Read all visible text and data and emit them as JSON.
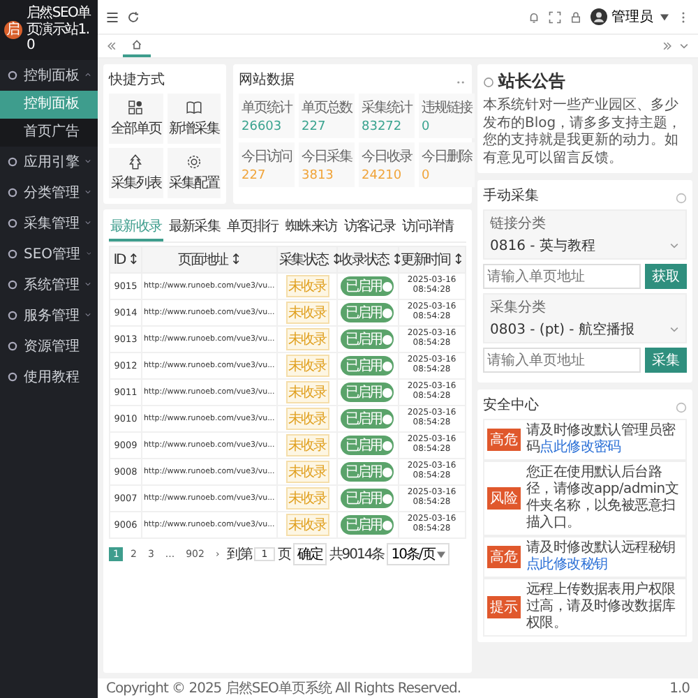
{
  "sidebar": {
    "logo_mark": "启",
    "title": "启然SEO单页演示站1.0",
    "items": [
      {
        "label": "控制面板",
        "kind": "group",
        "expanded": true,
        "children": [
          {
            "label": "控制面板",
            "selected": true
          },
          {
            "label": "首页广告",
            "selected": false
          }
        ]
      },
      {
        "label": "应用引擎",
        "kind": "group",
        "expanded": false
      },
      {
        "label": "分类管理",
        "kind": "group",
        "expanded": false
      },
      {
        "label": "采集管理",
        "kind": "group",
        "expanded": false
      },
      {
        "label": "SEO管理",
        "kind": "group",
        "expanded": false
      },
      {
        "label": "系统管理",
        "kind": "group",
        "expanded": false
      },
      {
        "label": "服务管理",
        "kind": "group",
        "expanded": false
      },
      {
        "label": "资源管理",
        "kind": "link"
      },
      {
        "label": "使用教程",
        "kind": "link"
      }
    ]
  },
  "topbar": {
    "user": "管理员"
  },
  "quick": {
    "title": "快捷方式",
    "items": [
      {
        "label": "全部单页"
      },
      {
        "label": "新增采集"
      },
      {
        "label": "采集列表"
      },
      {
        "label": "采集配置"
      }
    ]
  },
  "stats": {
    "title": "网站数据",
    "items": [
      {
        "label": "单页统计",
        "value": "26603",
        "color": "#3aa38f"
      },
      {
        "label": "单页总数",
        "value": "227",
        "color": "#3aa38f"
      },
      {
        "label": "采集统计",
        "value": "83272",
        "color": "#3aa38f"
      },
      {
        "label": "违规链接",
        "value": "0",
        "color": "#3aa38f"
      },
      {
        "label": "今日访问",
        "value": "227",
        "color": "#f0a43a"
      },
      {
        "label": "今日采集",
        "value": "3813",
        "color": "#f0a43a"
      },
      {
        "label": "今日收录",
        "value": "24210",
        "color": "#f0a43a"
      },
      {
        "label": "今日删除",
        "value": "0",
        "color": "#f0a43a"
      }
    ]
  },
  "table_tabs": [
    {
      "label": "最新收录",
      "selected": true
    },
    {
      "label": "最新采集",
      "selected": false
    },
    {
      "label": "单页排行",
      "selected": false
    },
    {
      "label": "蜘蛛来访",
      "selected": false
    },
    {
      "label": "访客记录",
      "selected": false
    },
    {
      "label": "访问详情",
      "selected": false
    }
  ],
  "table": {
    "columns": [
      "ID ↕",
      "页面地址 ↕",
      "采集状态 ↕",
      "收录状态 ↕",
      "更新时间 ↕"
    ],
    "rows": [
      {
        "id": "9015",
        "url": "http://www.runoeb.com/vue3/vu...",
        "status": "未收录",
        "toggle": "已启用",
        "on": true,
        "time": "2025-03-16 08:54:28"
      },
      {
        "id": "9014",
        "url": "http://www.runoeb.com/vue3/vu...",
        "status": "未收录",
        "toggle": "已启用",
        "on": true,
        "time": "2025-03-16 08:54:28"
      },
      {
        "id": "9013",
        "url": "http://www.runoeb.com/vue3/vu...",
        "status": "未收录",
        "toggle": "已启用",
        "on": true,
        "time": "2025-03-16 08:54:28"
      },
      {
        "id": "9012",
        "url": "http://www.runoeb.com/vue3/vu...",
        "status": "未收录",
        "toggle": "已启用",
        "on": true,
        "time": "2025-03-16 08:54:28"
      },
      {
        "id": "9011",
        "url": "http://www.runoeb.com/vue3/vu...",
        "status": "未收录",
        "toggle": "已启用",
        "on": true,
        "time": "2025-03-16 08:54:28"
      },
      {
        "id": "9010",
        "url": "http://www.runoeb.com/vue3/vu...",
        "status": "未收录",
        "toggle": "已启用",
        "on": true,
        "time": "2025-03-16 08:54:28"
      },
      {
        "id": "9009",
        "url": "http://www.runoeb.com/vue3/vu...",
        "status": "未收录",
        "toggle": "已启用",
        "on": true,
        "time": "2025-03-16 08:54:28"
      },
      {
        "id": "9008",
        "url": "http://www.runoeb.com/vue3/vu...",
        "status": "未收录",
        "toggle": "已启用",
        "on": true,
        "time": "2025-03-16 08:54:28"
      },
      {
        "id": "9007",
        "url": "http://www.runoeb.com/vue3/vu...",
        "status": "未收录",
        "toggle": "已启用",
        "on": true,
        "time": "2025-03-16 08:54:28"
      },
      {
        "id": "9006",
        "url": "http://www.runoeb.com/vue3/vu...",
        "status": "未收录",
        "toggle": "已启用",
        "on": true,
        "time": "2025-03-16 08:54:28"
      }
    ]
  },
  "pagination": {
    "pages": [
      {
        "label": "1",
        "selected": true
      },
      {
        "label": "2",
        "selected": false
      },
      {
        "label": "3",
        "selected": false
      },
      {
        "label": "...",
        "selected": false
      },
      {
        "label": "902",
        "selected": false
      }
    ],
    "next": "›",
    "goto": "到第",
    "page_value": "1",
    "page_unit": "页",
    "confirm": "确定",
    "total": "共9014条",
    "per_page": "10条/页"
  },
  "notice": {
    "title": "站长公告",
    "text": "本系统针对一些产业园区、多少发布的Blog，请多多支持主题，您的支持就是我更新的动力。如有意见可以留言反馈。"
  },
  "manual": {
    "title": "手动采集",
    "groups": [
      {
        "label": "链接分类",
        "select": "0816 - 英与教程",
        "placeholder": "请输入单页地址",
        "button": "获取"
      },
      {
        "label": "采集分类",
        "select": "0803 - (pt) - 航空播报",
        "placeholder": "请输入单页地址",
        "button": "采集"
      }
    ]
  },
  "security": {
    "title": "安全中心",
    "items": [
      {
        "tag": "高危",
        "text": "请及时修改默认管理员密码",
        "link": "点此修改密码"
      },
      {
        "tag": "风险",
        "text": "您正在使用默认后台路径，请修改app/admin文件夹名称，以免被恶意扫描入口。"
      },
      {
        "tag": "高危",
        "text": "请及时修改默认远程秘钥",
        "link": "点此修改秘钥"
      },
      {
        "tag": "提示",
        "text": "远程上传数据表用户权限过高，请及时修改数据库权限。"
      }
    ]
  },
  "footer": {
    "copyright": "Copyright © 2025 启然SEO单页系统 All Rights Reserved.",
    "version": "1.0"
  }
}
